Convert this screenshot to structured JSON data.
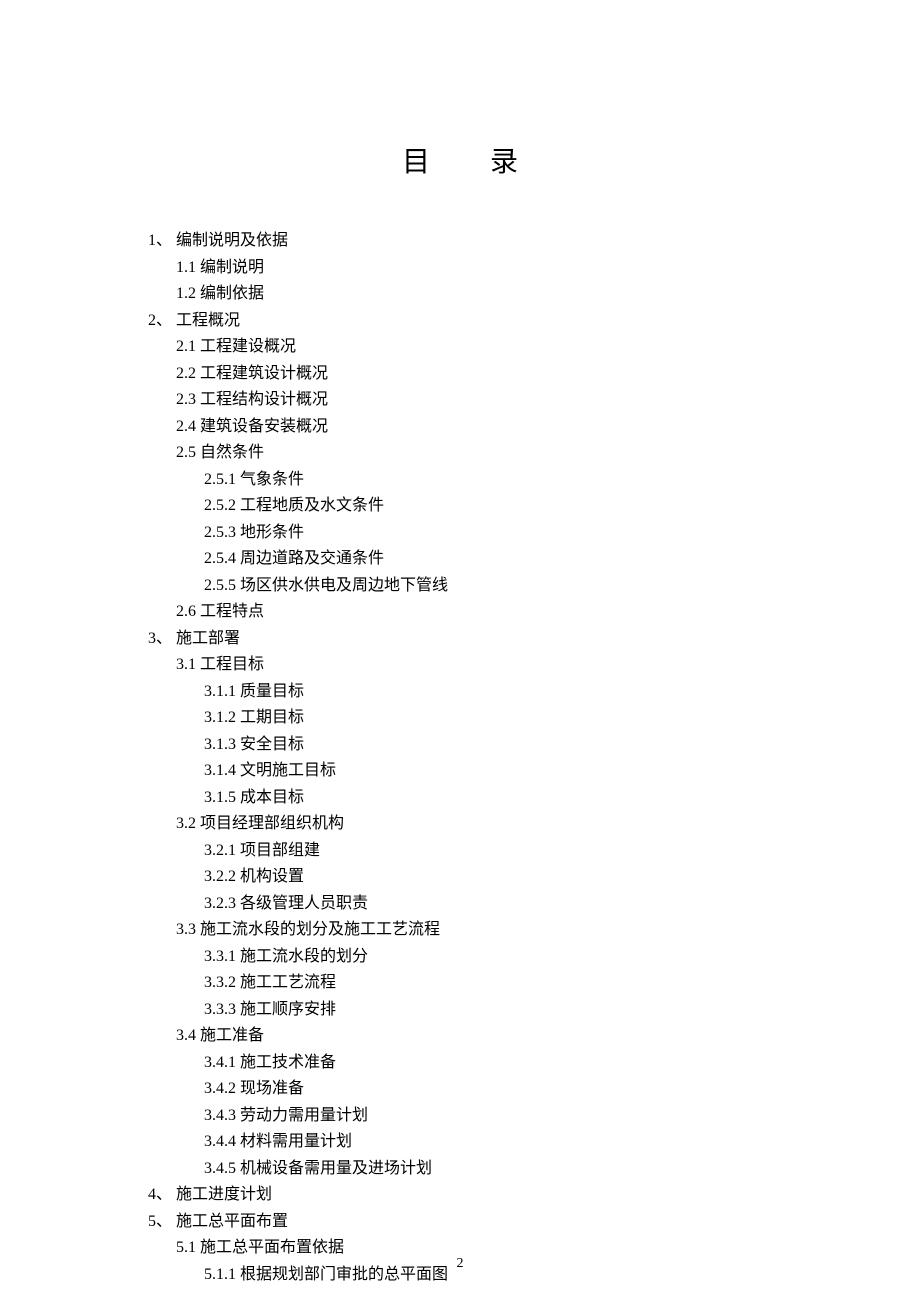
{
  "title_left": "目",
  "title_right": "录",
  "page_number": "2",
  "toc": [
    {
      "level": 1,
      "num": "1、",
      "text": "编制说明及依据"
    },
    {
      "level": 2,
      "num": "1.1",
      "text": "编制说明"
    },
    {
      "level": 2,
      "num": "1.2",
      "text": "编制依据"
    },
    {
      "level": 1,
      "num": "2、",
      "text": "工程概况"
    },
    {
      "level": 2,
      "num": "2.1",
      "text": "工程建设概况"
    },
    {
      "level": 2,
      "num": "2.2",
      "text": "工程建筑设计概况"
    },
    {
      "level": 2,
      "num": "2.3",
      "text": "工程结构设计概况"
    },
    {
      "level": 2,
      "num": "2.4",
      "text": "建筑设备安装概况"
    },
    {
      "level": 2,
      "num": "2.5",
      "text": "自然条件"
    },
    {
      "level": 3,
      "num": "2.5.1",
      "text": "气象条件"
    },
    {
      "level": 3,
      "num": "2.5.2",
      "text": "工程地质及水文条件"
    },
    {
      "level": 3,
      "num": "2.5.3",
      "text": "地形条件"
    },
    {
      "level": 3,
      "num": "2.5.4",
      "text": "周边道路及交通条件"
    },
    {
      "level": 3,
      "num": "2.5.5",
      "text": "场区供水供电及周边地下管线"
    },
    {
      "level": 2,
      "num": "2.6",
      "text": "工程特点"
    },
    {
      "level": 1,
      "num": "3、",
      "text": "施工部署"
    },
    {
      "level": 2,
      "num": "3.1",
      "text": "工程目标"
    },
    {
      "level": 3,
      "num": "3.1.1",
      "text": "质量目标"
    },
    {
      "level": 3,
      "num": "3.1.2",
      "text": "工期目标"
    },
    {
      "level": 3,
      "num": "3.1.3",
      "text": "安全目标"
    },
    {
      "level": 3,
      "num": "3.1.4",
      "text": "文明施工目标"
    },
    {
      "level": 3,
      "num": "3.1.5",
      "text": "成本目标"
    },
    {
      "level": 2,
      "num": "3.2",
      "text": "项目经理部组织机构"
    },
    {
      "level": 3,
      "num": "3.2.1",
      "text": "项目部组建"
    },
    {
      "level": 3,
      "num": "3.2.2",
      "text": "机构设置"
    },
    {
      "level": 3,
      "num": "3.2.3",
      "text": "各级管理人员职责"
    },
    {
      "level": 2,
      "num": "3.3",
      "text": "施工流水段的划分及施工工艺流程"
    },
    {
      "level": 3,
      "num": "3.3.1",
      "text": "施工流水段的划分"
    },
    {
      "level": 3,
      "num": "3.3.2",
      "text": "施工工艺流程"
    },
    {
      "level": 3,
      "num": "3.3.3",
      "text": "施工顺序安排"
    },
    {
      "level": 2,
      "num": "3.4",
      "text": "施工准备"
    },
    {
      "level": 3,
      "num": "3.4.1",
      "text": "施工技术准备"
    },
    {
      "level": 3,
      "num": "3.4.2",
      "text": "现场准备"
    },
    {
      "level": 3,
      "num": "3.4.3",
      "text": "劳动力需用量计划"
    },
    {
      "level": 3,
      "num": "3.4.4",
      "text": "材料需用量计划"
    },
    {
      "level": 3,
      "num": "3.4.5",
      "text": "机械设备需用量及进场计划"
    },
    {
      "level": 1,
      "num": "4、",
      "text": "施工进度计划"
    },
    {
      "level": 1,
      "num": "5、",
      "text": "施工总平面布置"
    },
    {
      "level": 2,
      "num": "5.1",
      "text": "施工总平面布置依据"
    },
    {
      "level": 3,
      "num": "5.1.1",
      "text": "根据规划部门审批的总平面图"
    }
  ]
}
